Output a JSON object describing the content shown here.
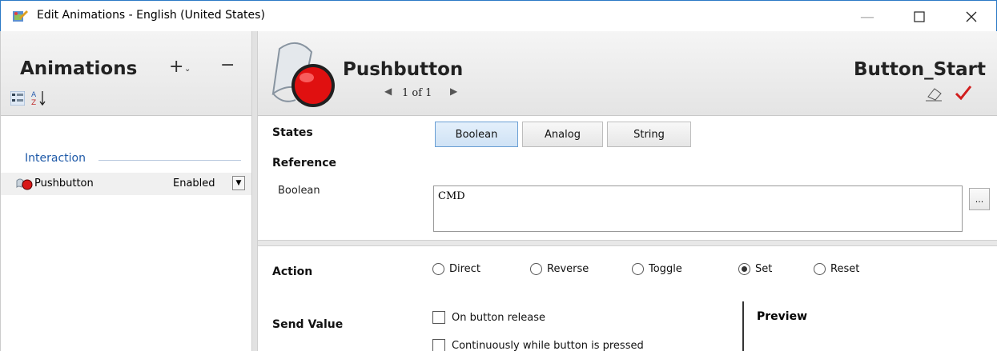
{
  "window": {
    "title": "Edit Animations - English (United States)",
    "minimize_icon": "minimize-icon",
    "maximize_icon": "maximize-icon",
    "close_icon": "close-icon",
    "border_color": "#2b79c5"
  },
  "left": {
    "title": "Animations",
    "add_symbol": "+",
    "add_dropdown_symbol": "⌄",
    "remove_symbol": "−",
    "group_label": "Interaction",
    "item": {
      "label": "Pushbutton",
      "value": "Enabled"
    }
  },
  "header": {
    "title": "Pushbutton",
    "page": "1 of 1",
    "name": "Button_Start",
    "check_color": "#d11e1e",
    "accent_color": "#e01010"
  },
  "states": {
    "label": "States",
    "buttons": [
      "Boolean",
      "Analog",
      "String"
    ],
    "selected": "Boolean"
  },
  "reference": {
    "label": "Reference",
    "field_label": "Boolean",
    "value": "CMD",
    "browse_label": "..."
  },
  "action": {
    "label": "Action",
    "options": [
      "Direct",
      "Reverse",
      "Toggle",
      "Set",
      "Reset"
    ],
    "selected": "Set"
  },
  "send_value": {
    "label": "Send Value",
    "options": [
      "On button release",
      "Continuously while button is pressed"
    ]
  },
  "preview": {
    "label": "Preview"
  }
}
